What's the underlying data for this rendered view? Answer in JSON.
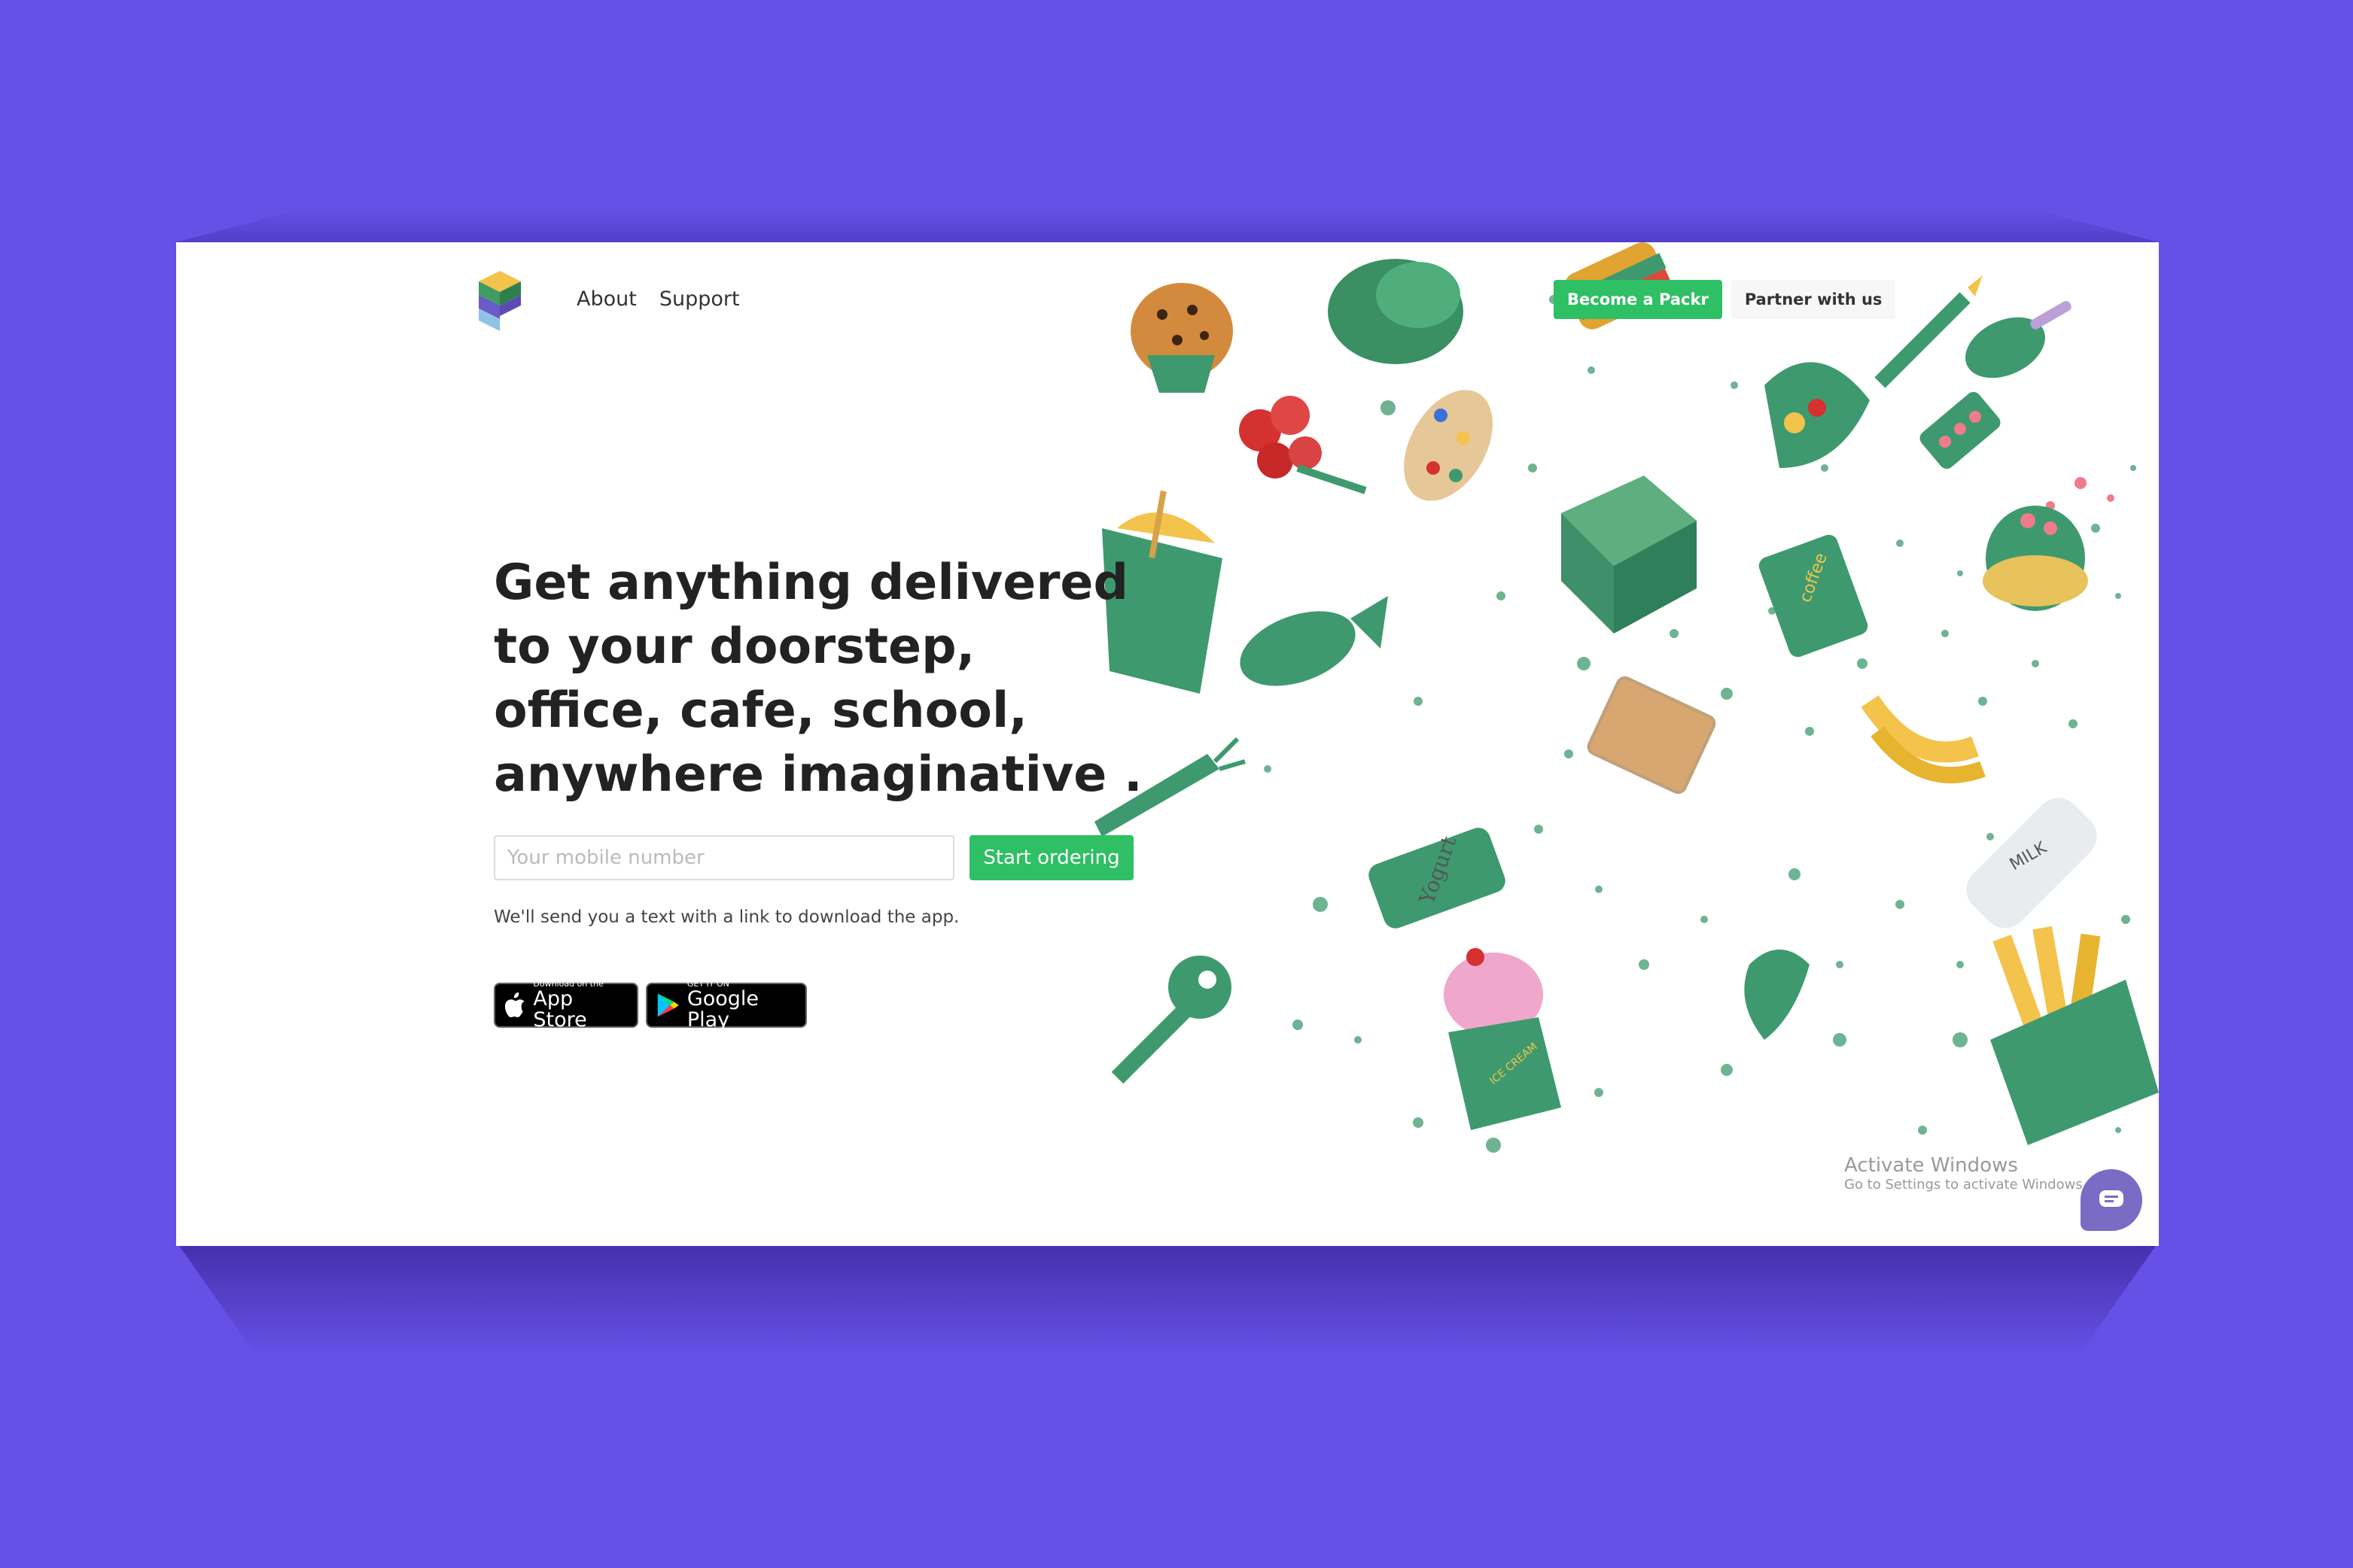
{
  "nav": {
    "about": "About",
    "support": "Support"
  },
  "header_actions": {
    "become": "Become a Packr",
    "partner": "Partner with us"
  },
  "hero": {
    "line1": "Get anything delivered",
    "line2": "to your doorstep,",
    "line3": "office, cafe, school,",
    "line4": "anywhere imaginative ."
  },
  "signup": {
    "placeholder": "Your mobile number",
    "button": "Start ordering",
    "hint": "We'll send you a text with a link to download the app."
  },
  "stores": {
    "apple_small": "Download on the",
    "apple_big": "App Store",
    "google_small": "GET IT ON",
    "google_big": "Google Play"
  },
  "windows_watermark": {
    "title": "Activate Windows",
    "subtitle": "Go to Settings to activate Windows."
  },
  "illustration_labels": {
    "coffee": "coffee",
    "yogurt": "Yogurt",
    "milk": "MILK",
    "ice_cream": "ICE CREAM"
  },
  "icons": [
    "packr-logo",
    "apple-icon",
    "google-play-icon",
    "chat-icon"
  ],
  "colors": {
    "background": "#6650e6",
    "accent": "#2fbf64",
    "illustration_green": "#3e9a6e"
  }
}
